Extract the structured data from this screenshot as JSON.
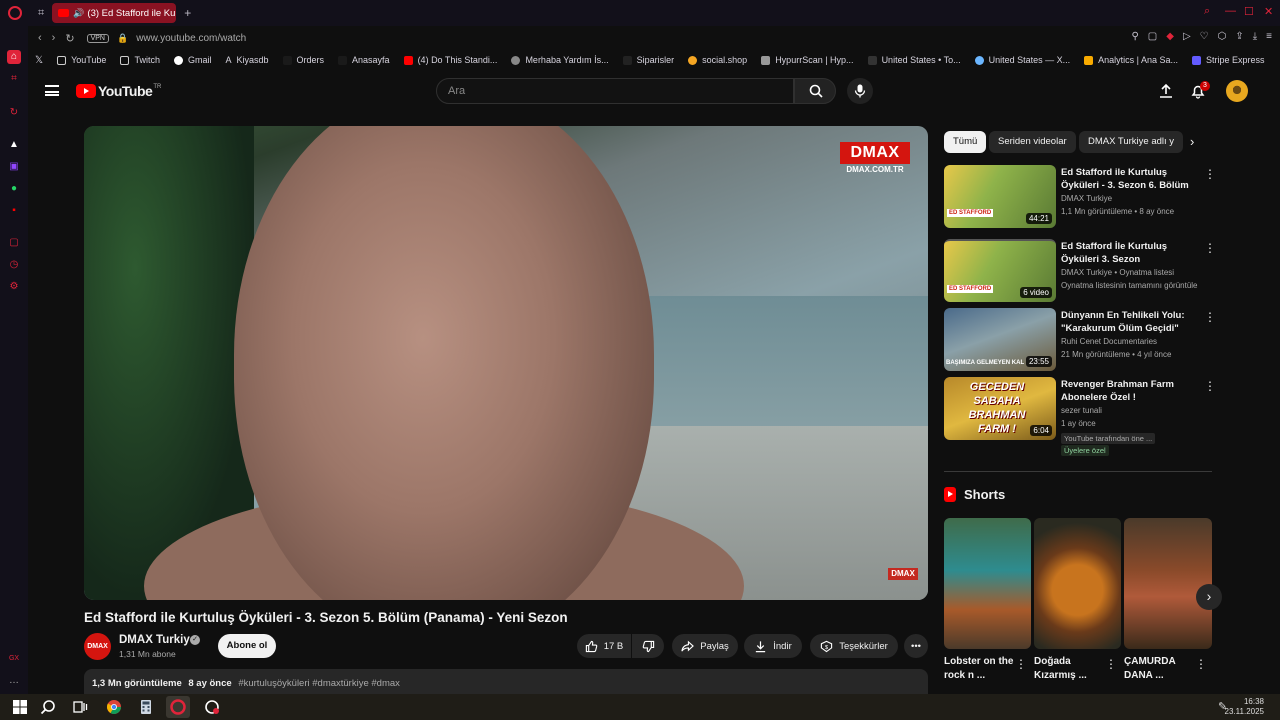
{
  "browser": {
    "tab_title": "(3) Ed Stafford ile Kurtu",
    "url": "www.youtube.com/watch",
    "vpn_label": "VPN",
    "bookmarks": [
      "YouTube",
      "Twitch",
      "Gmail",
      "Kiyasdb",
      "Orders",
      "Anasayfa",
      "(4) Do This Standi...",
      "Merhaba Yardım İs...",
      "Siparisler",
      "social.shop",
      "HypurrScan | Hyp...",
      "United States • To...",
      "United States — X...",
      "Analytics | Ana Sa...",
      "Stripe Express"
    ]
  },
  "youtube": {
    "logo_text": "YouTube",
    "logo_region": "TR",
    "search_placeholder": "Ara",
    "notification_count": "3"
  },
  "video": {
    "title": "Ed Stafford ile Kurtuluş Öyküleri - 3. Sezon 5. Bölüm (Panama) - Yeni Sezon",
    "watermark": "DMAX",
    "watermark_sub": "DMAX.COM.TR",
    "watermark_small": "DMAX",
    "channel": {
      "avatar_text": "DMAX",
      "name": "DMAX Turkiye",
      "subscribers": "1,31 Mn abone",
      "subscribe_label": "Abone ol"
    },
    "actions": {
      "likes": "17 B",
      "share": "Paylaş",
      "download": "İndir",
      "thanks": "Teşekkürler"
    },
    "description": {
      "views": "1,3 Mn görüntüleme",
      "age": "8 ay önce",
      "tags": "#kurtuluşöyküleri #dmaxtürkiye #dmax"
    }
  },
  "filters": [
    "Tümü",
    "Seriden videolar",
    "DMAX Turkiye adlı y"
  ],
  "recommendations": [
    {
      "title": "Ed Stafford ile Kurtuluş Öyküleri - 3. Sezon 6. Bölüm ...",
      "channel": "DMAX Turkiye",
      "meta": "1,1 Mn görüntüleme • 8 ay önce",
      "duration": "44:21"
    },
    {
      "title": "Ed Stafford İle Kurtuluş Öyküleri 3. Sezon",
      "channel": "DMAX Turkiye • Oynatma listesi",
      "meta": "Oynatma listesinin tamamını görüntüle",
      "duration": "6 video"
    },
    {
      "title": "Dünyanın En Tehlikeli Yolu: \"Karakurum Ölüm Geçidi\"",
      "channel": "Ruhi Cenet Documentaries",
      "meta": "21 Mn görüntüleme • 4 yıl önce",
      "duration": "23:55"
    },
    {
      "title": "Revenger Brahman Farm Abonelere Özel !",
      "channel": "sezer tunali",
      "meta": "1 ay önce",
      "duration": "6:04",
      "tag": "YouTube tarafından öne ...",
      "member": "Üyelere özel"
    }
  ],
  "thumb_texts": {
    "ed": "ED STAFFORD",
    "road": "BAŞIMIZA GELMEYEN KAL",
    "brahman": "GECEDEN SABAHA BRAHMAN FARM !"
  },
  "shorts": {
    "heading": "Shorts",
    "items": [
      {
        "title": "Lobster on the rock n ..."
      },
      {
        "title": "Doğada Kızarmış ..."
      },
      {
        "title": "ÇAMURDA DANA ..."
      }
    ]
  },
  "taskbar": {
    "time": "16:38",
    "date": "23.11.2025"
  }
}
